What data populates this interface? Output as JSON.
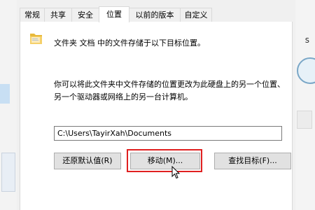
{
  "tabs": [
    {
      "label": "常规"
    },
    {
      "label": "共享"
    },
    {
      "label": "安全"
    },
    {
      "label": "位置"
    },
    {
      "label": "以前的版本"
    },
    {
      "label": "自定义"
    }
  ],
  "active_tab": "位置",
  "location": {
    "folder_description": "文件夹 文档 中的文件存储于以下目标位置。",
    "explanation_line1": "你可以将此文件夹中文件存储的位置更改为此硬盘上的另一个位置、",
    "explanation_line2": "另一个驱动器或网络上的另一台计算机。",
    "path_value": "C:\\Users\\TayirXah\\Documents"
  },
  "buttons": {
    "restore": "还原默认值(R)",
    "move": "移动(M)...",
    "find_target": "查找目标(F)..."
  },
  "background": {
    "right_edge_text": "s"
  },
  "colors": {
    "highlight": "#e02020",
    "folder_yellow": "#f2c84b"
  }
}
